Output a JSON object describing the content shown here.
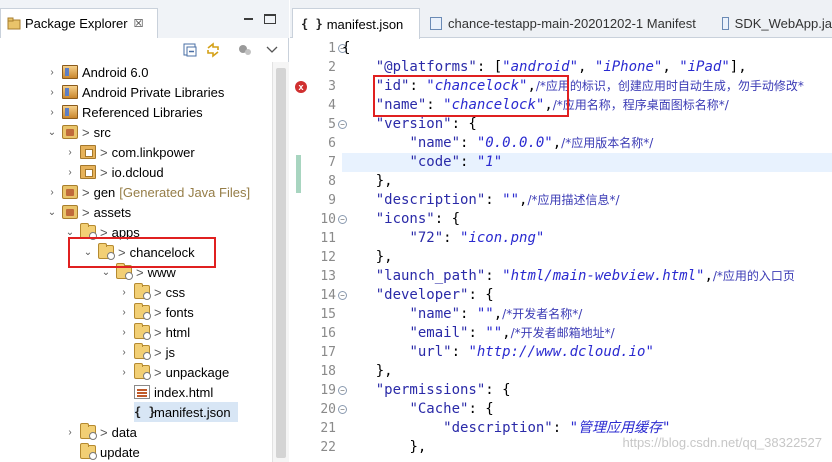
{
  "explorer": {
    "title": "Package Explorer",
    "close_glyph": "☒",
    "tree": [
      {
        "label": "Android 6.0",
        "arrow": "›",
        "icon": "library-icon",
        "prefix": ""
      },
      {
        "label": "Android Private Libraries",
        "arrow": "›",
        "icon": "library-icon",
        "prefix": ""
      },
      {
        "label": "Referenced Libraries",
        "arrow": "›",
        "icon": "library-icon",
        "prefix": ""
      },
      {
        "label": "src",
        "arrow": "⌄",
        "icon": "source-folder-icon",
        "prefix": ">"
      },
      {
        "label": "com.linkpower",
        "arrow": "›",
        "icon": "package-icon",
        "prefix": ">"
      },
      {
        "label": "io.dcloud",
        "arrow": "›",
        "icon": "package-icon",
        "prefix": ">"
      },
      {
        "label": "gen",
        "arrow": "›",
        "icon": "source-folder-icon",
        "prefix": ">",
        "decoration": "[Generated Java Files]"
      },
      {
        "label": "assets",
        "arrow": "⌄",
        "icon": "source-folder-icon",
        "prefix": ">"
      },
      {
        "label": "apps",
        "arrow": "⌄",
        "icon": "folder-icon",
        "prefix": ">"
      },
      {
        "label": "chancelock",
        "arrow": "⌄",
        "icon": "folder-icon",
        "prefix": ">"
      },
      {
        "label": "www",
        "arrow": "⌄",
        "icon": "folder-icon",
        "prefix": ">"
      },
      {
        "label": "css",
        "arrow": "›",
        "icon": "folder-icon",
        "prefix": ">"
      },
      {
        "label": "fonts",
        "arrow": "›",
        "icon": "folder-icon",
        "prefix": ">"
      },
      {
        "label": "html",
        "arrow": "›",
        "icon": "folder-icon",
        "prefix": ">"
      },
      {
        "label": "js",
        "arrow": "›",
        "icon": "folder-icon",
        "prefix": ">"
      },
      {
        "label": "unpackage",
        "arrow": "›",
        "icon": "folder-icon",
        "prefix": ">"
      },
      {
        "label": "index.html",
        "arrow": "",
        "icon": "html-file-icon",
        "prefix": ""
      },
      {
        "label": "manifest.json",
        "arrow": "",
        "icon": "json-file-icon",
        "prefix": ""
      },
      {
        "label": "data",
        "arrow": "›",
        "icon": "folder-icon",
        "prefix": ">"
      },
      {
        "label": "update",
        "arrow": "",
        "icon": "folder-icon",
        "prefix": ""
      }
    ]
  },
  "editor": {
    "tabs": [
      {
        "label": "manifest.json",
        "icon": "{ }",
        "active": true
      },
      {
        "label": "chance-testapp-main-20201202-1 Manifest",
        "icon": "manifest-icon",
        "active": false
      },
      {
        "label": "SDK_WebApp.ja",
        "icon": "file-icon",
        "active": false
      }
    ],
    "line_numbers": [
      "1",
      "2",
      "3",
      "4",
      "5",
      "6",
      "7",
      "8",
      "9",
      "10",
      "11",
      "12",
      "13",
      "14",
      "15",
      "16",
      "17",
      "18",
      "19",
      "20",
      "21",
      "22"
    ],
    "error_line": "3",
    "current_line": "7",
    "watermark": "https://blog.csdn.net/qq_38322527"
  },
  "code": {
    "l1": "{",
    "l2_key": "\"@platforms\"",
    "l2_rest": ": [",
    "l2_v1": "\"android\"",
    "l2_v2": "\"iPhone\"",
    "l2_v3": "\"iPad\"",
    "l2_end": "],",
    "l3_key": "\"id\"",
    "l3_val": "\"chancelock\"",
    "l3_comment": "/*应用的标识，创建应用时自动生成，勿手动修改*",
    "l4_key": "\"name\"",
    "l4_val": "\"chancelock\"",
    "l4_comment": "/*应用名称，程序桌面图标名称*/",
    "l5_key": "\"version\"",
    "l5_rest": ": {",
    "l6_key": "\"name\"",
    "l6_val": "\"0.0.0.0\"",
    "l6_comment": "/*应用版本名称*/",
    "l7_key": "\"code\"",
    "l7_val": "\"1\"",
    "l8": "},",
    "l9_key": "\"description\"",
    "l9_val": "\"\"",
    "l9_comment": "/*应用描述信息*/",
    "l10_key": "\"icons\"",
    "l10_rest": ": {",
    "l11_key": "\"72\"",
    "l11_val": "\"icon.png\"",
    "l12": "},",
    "l13_key": "\"launch_path\"",
    "l13_val": "\"html/main-webview.html\"",
    "l13_comment": "/*应用的入口页",
    "l14_key": "\"developer\"",
    "l14_rest": ": {",
    "l15_key": "\"name\"",
    "l15_val": "\"\"",
    "l15_comment": "/*开发者名称*/",
    "l16_key": "\"email\"",
    "l16_val": "\"\"",
    "l16_comment": "/*开发者邮箱地址*/",
    "l17_key": "\"url\"",
    "l17_val": "\"http://www.dcloud.io\"",
    "l18": "},",
    "l19_key": "\"permissions\"",
    "l19_rest": ": {",
    "l20_key": "\"Cache\"",
    "l20_rest": ": {",
    "l21_key": "\"description\"",
    "l21_val": "\"管理应用缓存\"",
    "l22": "},"
  }
}
